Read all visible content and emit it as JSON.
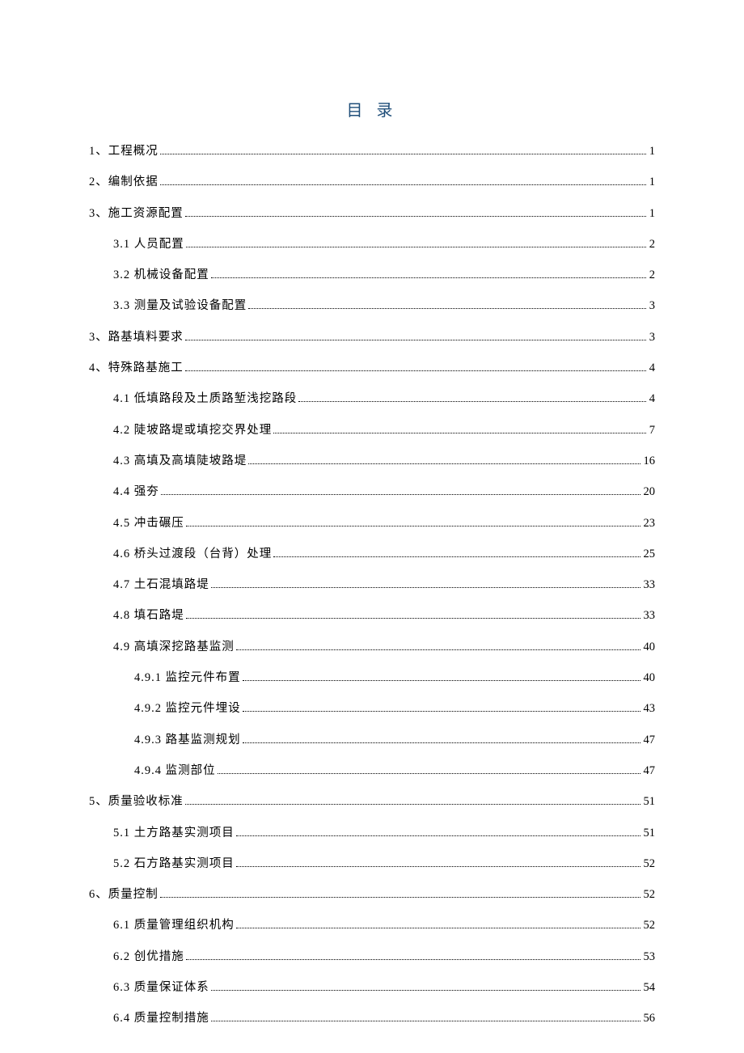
{
  "title": "目 录",
  "toc": [
    {
      "level": 0,
      "label": "1、工程概况",
      "page": "1"
    },
    {
      "level": 0,
      "label": "2、编制依据",
      "page": "1"
    },
    {
      "level": 0,
      "label": "3、施工资源配置",
      "page": "1"
    },
    {
      "level": 1,
      "label": "3.1 人员配置",
      "page": "2"
    },
    {
      "level": 1,
      "label": "3.2 机械设备配置",
      "page": "2"
    },
    {
      "level": 1,
      "label": "3.3 测量及试验设备配置",
      "page": "3"
    },
    {
      "level": 0,
      "label": "3、路基填料要求",
      "page": "3"
    },
    {
      "level": 0,
      "label": "4、特殊路基施工",
      "page": "4"
    },
    {
      "level": 1,
      "label": "4.1 低填路段及土质路堑浅挖路段",
      "page": "4"
    },
    {
      "level": 1,
      "label": "4.2 陡坡路堤或填挖交界处理",
      "page": "7"
    },
    {
      "level": 1,
      "label": "4.3 高填及高填陡坡路堤",
      "page": "16"
    },
    {
      "level": 1,
      "label": "4.4 强夯",
      "page": "20"
    },
    {
      "level": 1,
      "label": "4.5 冲击碾压",
      "page": "23"
    },
    {
      "level": 1,
      "label": "4.6 桥头过渡段（台背）处理",
      "page": "25"
    },
    {
      "level": 1,
      "label": "4.7 土石混填路堤",
      "page": "33"
    },
    {
      "level": 1,
      "label": "4.8 填石路堤",
      "page": "33"
    },
    {
      "level": 1,
      "label": "4.9 高填深挖路基监测",
      "page": "40"
    },
    {
      "level": 2,
      "label": "4.9.1 监控元件布置",
      "page": "40"
    },
    {
      "level": 2,
      "label": "4.9.2 监控元件埋设",
      "page": "43"
    },
    {
      "level": 2,
      "label": "4.9.3 路基监测规划",
      "page": "47"
    },
    {
      "level": 2,
      "label": "4.9.4 监测部位",
      "page": "47"
    },
    {
      "level": 0,
      "label": "5、质量验收标准",
      "page": "51"
    },
    {
      "level": 1,
      "label": "5.1 土方路基实测项目",
      "page": "51"
    },
    {
      "level": 1,
      "label": "5.2 石方路基实测项目",
      "page": "52"
    },
    {
      "level": 0,
      "label": "6、质量控制",
      "page": "52"
    },
    {
      "level": 1,
      "label": "6.1 质量管理组织机构",
      "page": "52"
    },
    {
      "level": 1,
      "label": "6.2 创优措施",
      "page": "53"
    },
    {
      "level": 1,
      "label": "6.3 质量保证体系",
      "page": "54"
    },
    {
      "level": 1,
      "label": "6.4 质量控制措施",
      "page": "56"
    }
  ]
}
